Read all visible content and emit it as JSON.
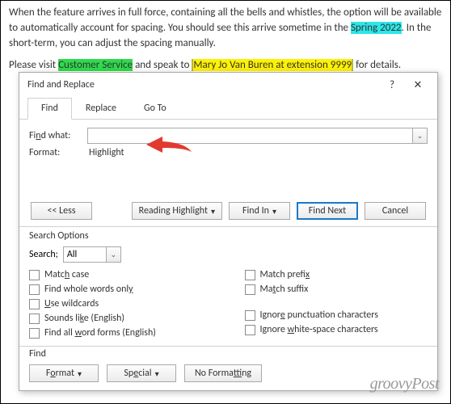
{
  "doc": {
    "p1_a": "When the feature arrives in full force, containing all the bells and whistles, the option will be available to automatically account for spacing. You should see this arrive sometime in the ",
    "p1_b": "Spring 2022",
    "p1_c": ". In the short-term, you can adjust the spacing manually.",
    "p2_a": "Please visit ",
    "p2_b": "Customer Service",
    "p2_c": " and speak to ",
    "p2_d": "Mary Jo Van Buren at extension 9999",
    "p2_e": " for details."
  },
  "dialog": {
    "title": "Find and Replace",
    "help": "?",
    "close": "✕",
    "tabs": {
      "find": "Find",
      "replace": "Replace",
      "goto": "Go To"
    },
    "findwhat_label": "Find what:",
    "findwhat_value": "",
    "format_label": "Format:",
    "format_value": "Highlight",
    "btn_less": "<<  Less",
    "btn_reading": "Reading Highlight",
    "btn_findin": "Find In",
    "btn_findnext": "Find Next",
    "btn_cancel": "Cancel",
    "searchoptions": "Search Options",
    "search_label": "Search;",
    "search_value": "All",
    "chk_matchcase": "Match case",
    "chk_wholewords": "Find whole words only",
    "chk_wildcards": "Use wildcards",
    "chk_sounds": "Sounds like (English)",
    "chk_wordforms": "Find all word forms (English)",
    "chk_prefix": "Match prefix",
    "chk_suffix": "Match suffix",
    "chk_punct": "Ignore punctuation characters",
    "chk_white": "Ignore white-space characters",
    "find_section": "Find",
    "btn_format": "Format",
    "btn_special": "Special",
    "btn_nofmt": "No Formatting"
  },
  "watermark": "groovyPost"
}
